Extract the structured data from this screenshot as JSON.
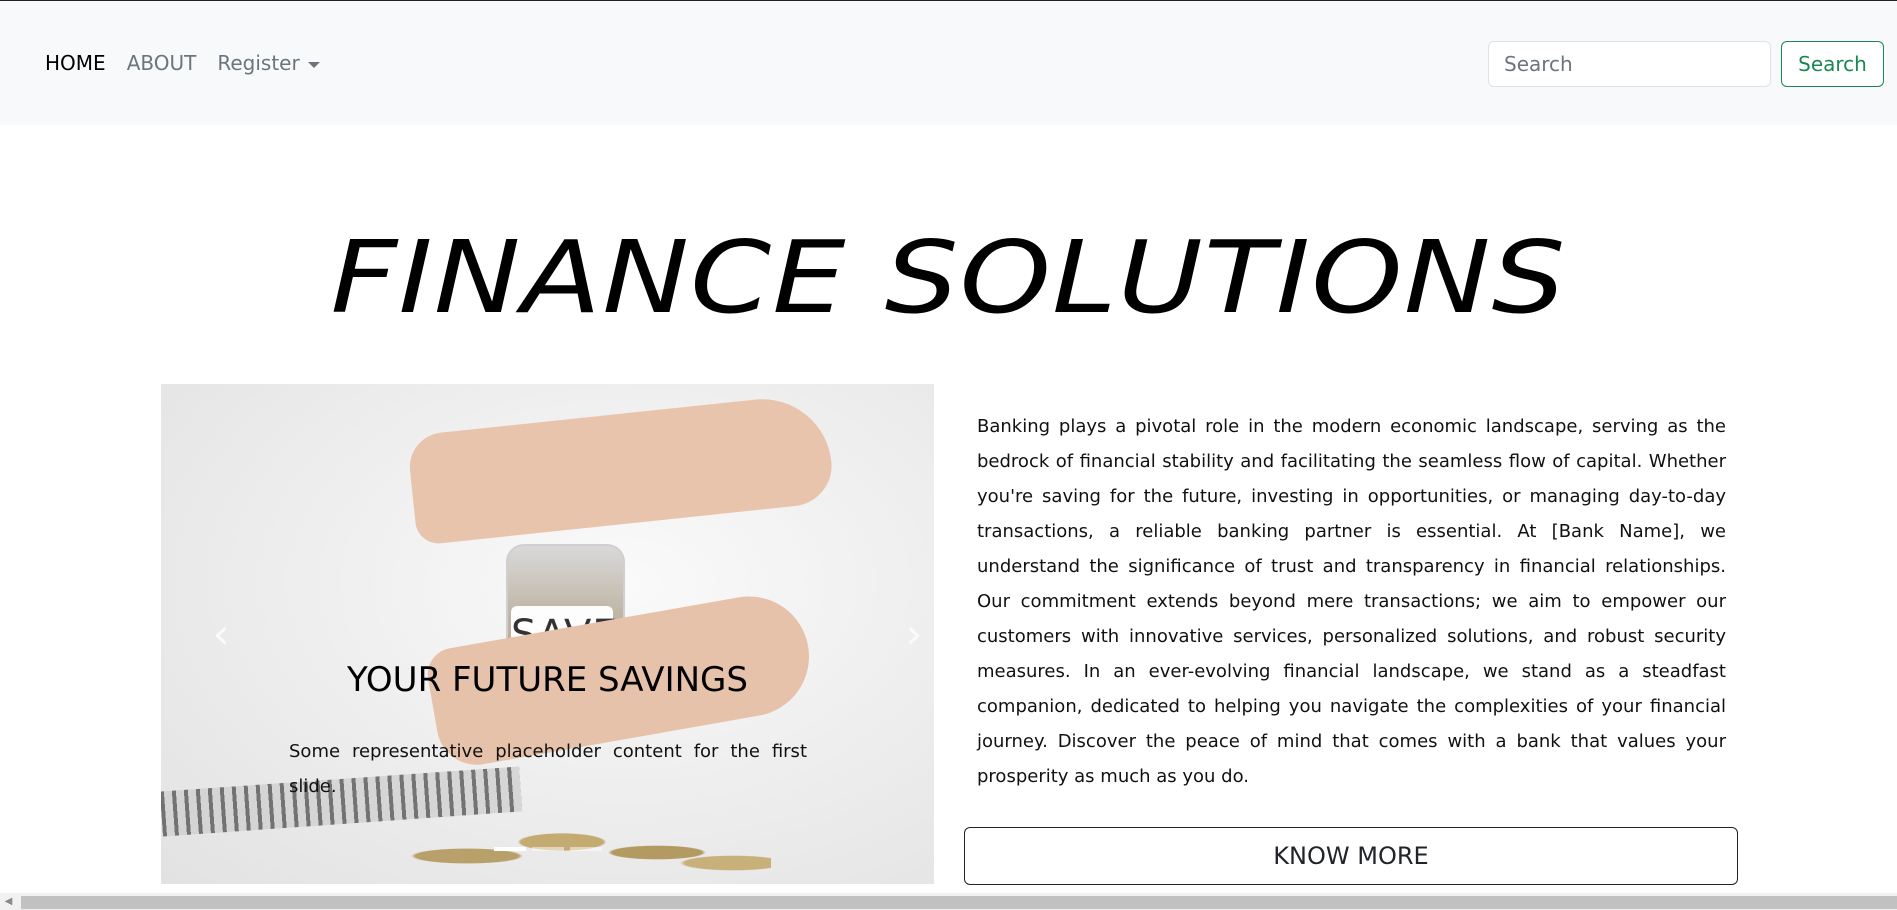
{
  "nav": {
    "items": [
      {
        "label": "HOME",
        "active": true
      },
      {
        "label": "ABOUT",
        "active": false
      },
      {
        "label": "Register",
        "active": false,
        "dropdown": true
      }
    ],
    "search_placeholder": "Search",
    "search_button": "Search"
  },
  "hero": {
    "title": "FINANCE SOLUTIONS"
  },
  "carousel": {
    "prev_icon": "chevron-left-icon",
    "next_icon": "chevron-right-icon",
    "jar_label": "SAVE",
    "caption_title": "YOUR FUTURE SAVINGS",
    "caption_text": "Some representative placeholder content for the first slide.",
    "slides_total": 3,
    "active_slide": 1
  },
  "about": {
    "text": "Banking plays a pivotal role in the modern economic landscape, serving as the bedrock of financial stability and facilitating the seamless flow of capital. Whether you're saving for the future, investing in opportunities, or managing day-to-day transactions, a reliable banking partner is essential. At [Bank Name], we understand the significance of trust and transparency in financial relationships. Our commitment extends beyond mere transactions; we aim to empower our customers with innovative services, personalized solutions, and robust security measures. In an ever-evolving financial landscape, we stand as a steadfast companion, dedicated to helping you navigate the complexities of your financial journey. Discover the peace of mind that comes with a bank that values your prosperity as much as you do.",
    "button": "KNOW MORE"
  },
  "colors": {
    "accent": "#198754",
    "navbar_bg": "#f8f9fa",
    "text": "#212529"
  }
}
